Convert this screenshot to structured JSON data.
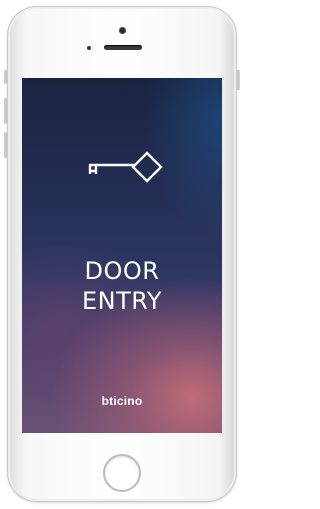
{
  "app": {
    "title_line1": "DOOR",
    "title_line2": "ENTRY",
    "brand": "bticino"
  },
  "icons": {
    "key": "key-icon"
  },
  "colors": {
    "screen_top": "#1a2340",
    "screen_bottom_glow": "#c46e78",
    "text": "#ffffff",
    "phone_body": "#ffffff"
  }
}
